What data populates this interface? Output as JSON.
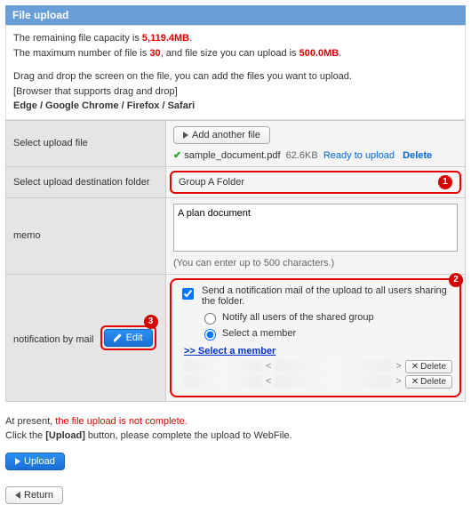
{
  "header": {
    "title": "File upload"
  },
  "capacity": {
    "line1_pre": "The remaining file capacity is ",
    "remaining": "5,119.4MB",
    "line2_pre": "The maximum number of file is ",
    "max_files": "30",
    "line2_mid": ", and file size you can upload is ",
    "max_size": "500.0MB",
    "drag_hint": "Drag and drop the screen on the file, you can add the files you want to upload.",
    "browser_hint": "[Browser that supports drag and drop]",
    "browsers": "Edge / Google Chrome / Firefox / Safari"
  },
  "rows": {
    "select_file_label": "Select upload file",
    "dest_label": "Select upload destination folder",
    "memo_label": "memo",
    "notif_label": "notification by mail"
  },
  "upload_file": {
    "add_btn": "Add another file",
    "file_name": "sample_document.pdf",
    "file_size": "62.6KB",
    "status": "Ready to upload",
    "delete": "Delete"
  },
  "dest": {
    "folder": "Group A Folder",
    "marker": "1"
  },
  "memo": {
    "value": "A plan document",
    "hint": "(You can enter up to 500 characters.)"
  },
  "notif": {
    "marker": "2",
    "checkbox_label": "Send a notification mail of the upload to all users sharing the folder.",
    "opt_all": "Notify all users of the shared group",
    "opt_select": "Select a member",
    "member_link": ">> Select a member",
    "delete_btn": "Delete",
    "edit_marker": "3",
    "edit_btn": "Edit"
  },
  "status": {
    "pre": "At present, ",
    "warn": "the file upload is not complete.",
    "post1": "Click the ",
    "upload_word": "[Upload]",
    "post2": " button, please complete the upload to WebFile."
  },
  "buttons": {
    "upload": "Upload",
    "return": "Return"
  }
}
